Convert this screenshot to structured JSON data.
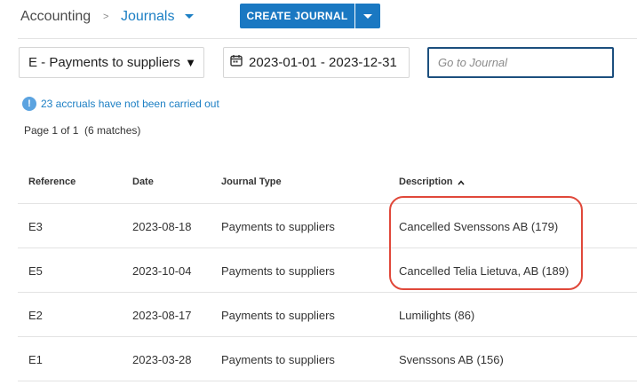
{
  "breadcrumb": {
    "root": "Accounting",
    "separator": ">",
    "current": "Journals"
  },
  "toolbar": {
    "create_label": "CREATE JOURNAL"
  },
  "filters": {
    "journal_type": "E - Payments to suppliers",
    "journal_type_arrow": "▼",
    "date_range": "2023-01-01 - 2023-12-31",
    "goto_placeholder": "Go to Journal"
  },
  "notice": {
    "icon": "!",
    "text": "23 accruals have not been carried out"
  },
  "pagination": {
    "text": "Page 1 of 1  (6 matches)"
  },
  "table": {
    "columns": [
      "Reference",
      "Date",
      "Journal Type",
      "Description"
    ],
    "sort": {
      "column": "Description",
      "direction": "ascending"
    },
    "rows": [
      [
        "E3",
        "2023-08-18",
        "Payments to suppliers",
        "Cancelled Svenssons AB (179)"
      ],
      [
        "E5",
        "2023-10-04",
        "Payments to suppliers",
        "Cancelled Telia Lietuva, AB (189)"
      ],
      [
        "E2",
        "2023-08-17",
        "Payments to suppliers",
        "Lumilights (86)"
      ],
      [
        "E1",
        "2023-03-28",
        "Payments to suppliers",
        "Svenssons AB (156)"
      ]
    ]
  },
  "colors": {
    "accent": "#1a78c2",
    "link": "#1c7fc4",
    "highlight": "#e0483a"
  }
}
